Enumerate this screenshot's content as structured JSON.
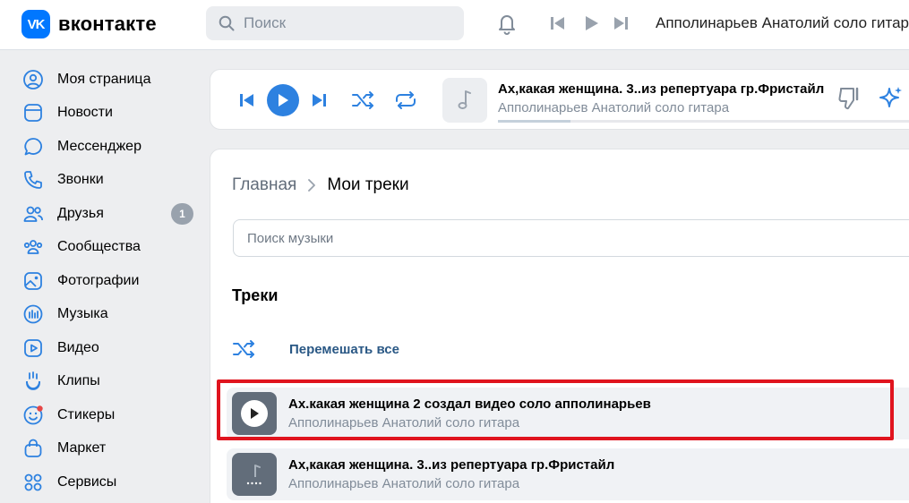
{
  "header": {
    "logo_mark": "VK",
    "logo_text": "вконтакте",
    "search_placeholder": "Поиск",
    "now_playing": "Апполинарьев Анатолий соло гитара"
  },
  "sidebar": {
    "items": [
      {
        "label": "Моя страница",
        "icon": "profile-icon"
      },
      {
        "label": "Новости",
        "icon": "news-icon"
      },
      {
        "label": "Мессенджер",
        "icon": "messenger-icon"
      },
      {
        "label": "Звонки",
        "icon": "phone-icon"
      },
      {
        "label": "Друзья",
        "icon": "friends-icon",
        "badge": "1"
      },
      {
        "label": "Сообщества",
        "icon": "communities-icon"
      },
      {
        "label": "Фотографии",
        "icon": "photos-icon"
      },
      {
        "label": "Музыка",
        "icon": "music-icon"
      },
      {
        "label": "Видео",
        "icon": "video-icon"
      },
      {
        "label": "Клипы",
        "icon": "clips-icon"
      },
      {
        "label": "Стикеры",
        "icon": "stickers-icon"
      },
      {
        "label": "Маркет",
        "icon": "market-icon"
      },
      {
        "label": "Сервисы",
        "icon": "services-icon"
      }
    ]
  },
  "player": {
    "title": "Ах,какая женщина. 3..из репертуара гр.Фристайл",
    "artist": "Апполинарьев Анатолий соло гитара",
    "progress": 0.17
  },
  "main": {
    "breadcrumb_home": "Главная",
    "breadcrumb_current": "Мои треки",
    "search_placeholder": "Поиск музыки",
    "section_title": "Треки",
    "shuffle_label": "Перемешать все",
    "tracks": [
      {
        "title": "Ах.какая женщина 2 создал видео соло апполинарьев",
        "artist": "Апполинарьев Анатолий соло гитара"
      },
      {
        "title": "Ах,какая женщина. 3..из репертуара гр.Фристайл",
        "artist": "Апполинарьев Анатолий соло гитара"
      }
    ]
  },
  "colors": {
    "accent": "#2d81e0",
    "brand": "#0077ff",
    "highlight": "#e0141e",
    "link": "#2a5885"
  }
}
